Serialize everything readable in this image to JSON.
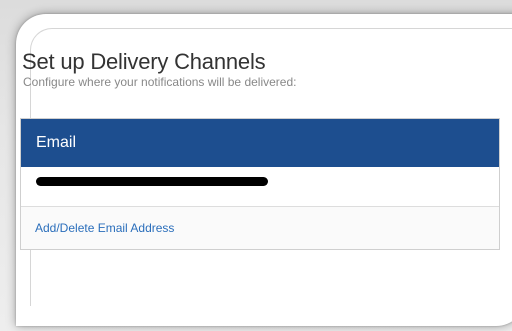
{
  "section": {
    "title": "Set up Delivery Channels",
    "subtitle": "Configure where your notifications will be delivered:"
  },
  "email_panel": {
    "header": "Email",
    "email_address": "",
    "email_redacted": true,
    "add_delete_link": "Add/Delete Email Address"
  },
  "colors": {
    "header_background": "#1d4e8f",
    "link": "#2a6ebb"
  }
}
